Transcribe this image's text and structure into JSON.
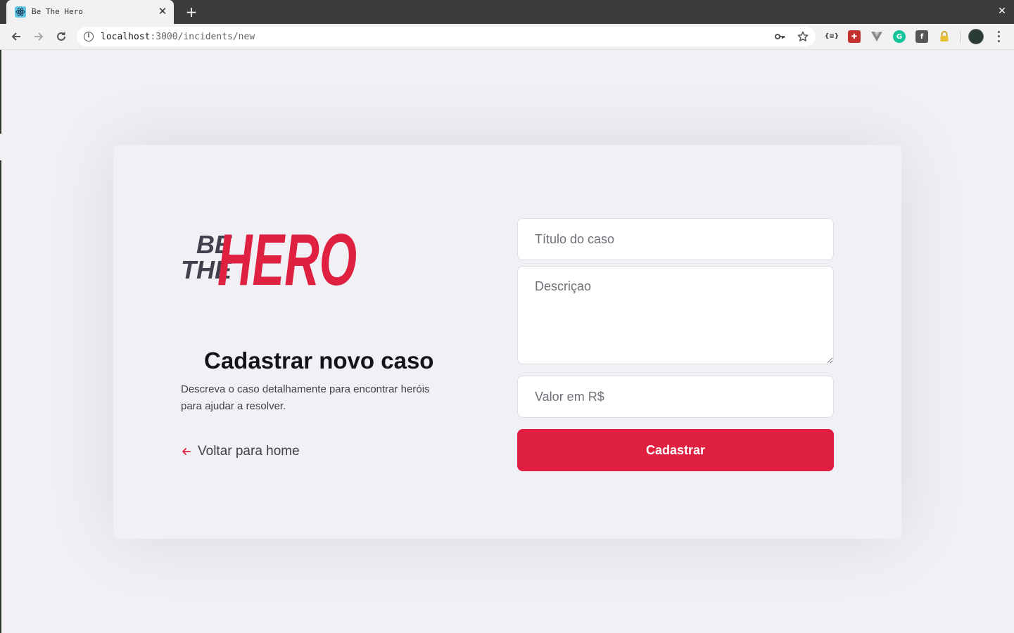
{
  "browser": {
    "tab_title": "Be The Hero",
    "url_host": "localhost",
    "url_rest": ":3000/incidents/new",
    "new_tab_label": "+",
    "close_tab_label": "✕",
    "close_window_label": "✕",
    "extensions": [
      "code-ext-icon",
      "puzzle-ext-icon",
      "vue-ext-icon",
      "grammarly-ext-icon",
      "facebook-ext-icon",
      "lock-ext-icon"
    ]
  },
  "logo": {
    "line1": "BE",
    "line2": "THE",
    "word": "HERO",
    "dark_color": "#41414d",
    "brand_color": "#e02041"
  },
  "page": {
    "title": "Cadastrar novo caso",
    "description": "Descreva o caso detalhamente para encontrar heróis para ajudar a resolver.",
    "back_label": "Voltar para home"
  },
  "form": {
    "title_placeholder": "Título do caso",
    "description_placeholder": "Descriçao",
    "value_placeholder": "Valor em R$",
    "submit_label": "Cadastrar"
  },
  "colors": {
    "accent": "#e02041",
    "background": "#f0f0f5",
    "text": "#41414d"
  }
}
